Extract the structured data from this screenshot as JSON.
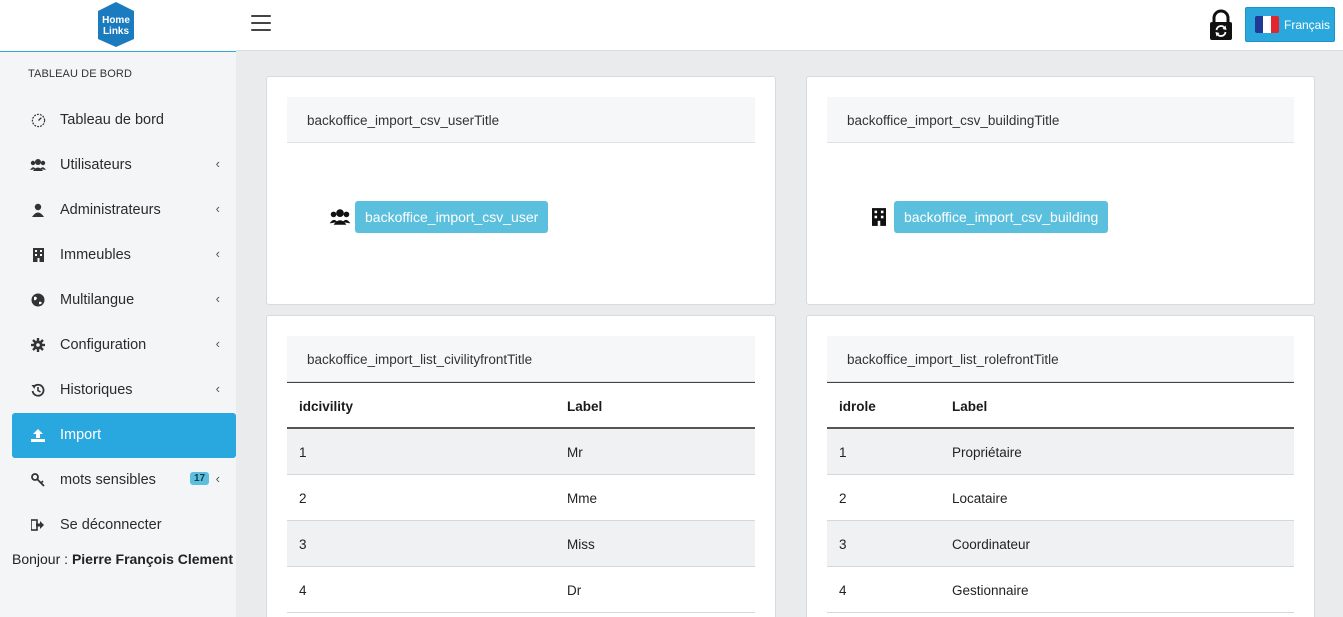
{
  "brand": {
    "logo_line1": "Home",
    "logo_line2": "Links",
    "color": "#1a7bbf"
  },
  "sidebar": {
    "section_title": "TABLEAU DE BORD",
    "items": [
      {
        "label": "Tableau de bord",
        "icon": "dashboard-gauge-icon"
      },
      {
        "label": "Utilisateurs",
        "icon": "users-icon"
      },
      {
        "label": "Administrateurs",
        "icon": "user-icon"
      },
      {
        "label": "Immeubles",
        "icon": "building-icon"
      },
      {
        "label": "Multilangue",
        "icon": "globe-icon"
      },
      {
        "label": "Configuration",
        "icon": "gear-icon"
      },
      {
        "label": "Historiques",
        "icon": "history-icon"
      },
      {
        "label": "Import",
        "icon": "upload-icon",
        "active": true
      },
      {
        "label": "mots sensibles",
        "icon": "key-icon",
        "badge": "17"
      },
      {
        "label": "Se déconnecter",
        "icon": "sign-out-icon"
      }
    ],
    "greeting_prefix": "Bonjour : ",
    "greeting_name": "Pierre François Clement"
  },
  "topbar": {
    "language_label": "Français",
    "accent_color": "#2aa8de"
  },
  "cards": {
    "user_import": {
      "title": "backoffice_import_csv_userTitle",
      "button": "backoffice_import_csv_user"
    },
    "building_import": {
      "title": "backoffice_import_csv_buildingTitle",
      "button": "backoffice_import_csv_building"
    },
    "civility": {
      "title": "backoffice_import_list_civilityfrontTitle",
      "headers": [
        "idcivility",
        "Label"
      ],
      "rows": [
        [
          "1",
          "Mr"
        ],
        [
          "2",
          "Mme"
        ],
        [
          "3",
          "Miss"
        ],
        [
          "4",
          "Dr"
        ]
      ]
    },
    "role": {
      "title": "backoffice_import_list_rolefrontTitle",
      "headers": [
        "idrole",
        "Label"
      ],
      "rows": [
        [
          "1",
          "Propriétaire"
        ],
        [
          "2",
          "Locataire"
        ],
        [
          "3",
          "Coordinateur"
        ],
        [
          "4",
          "Gestionnaire"
        ]
      ]
    }
  }
}
